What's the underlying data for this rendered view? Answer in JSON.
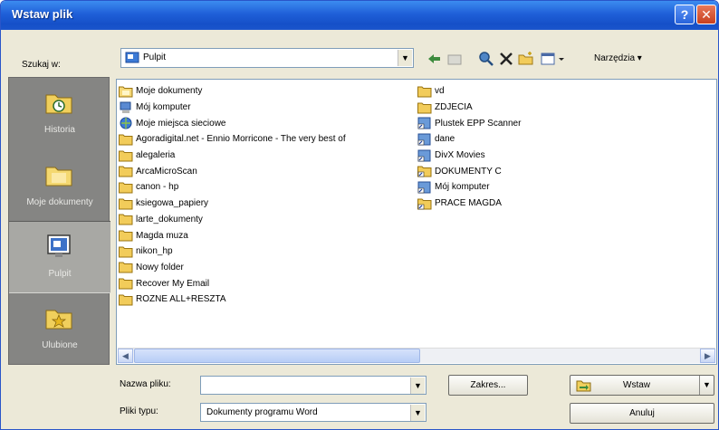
{
  "window": {
    "title": "Wstaw plik"
  },
  "toolbar": {
    "look_in_label": "Szukaj w:",
    "look_in_value": "Pulpit",
    "tools_label": "Narzędzia"
  },
  "places": [
    {
      "label": "Historia"
    },
    {
      "label": "Moje dokumenty"
    },
    {
      "label": "Pulpit"
    },
    {
      "label": "Ulubione"
    }
  ],
  "files": {
    "column1": [
      {
        "name": "Moje dokumenty",
        "icon": "my-documents-icon"
      },
      {
        "name": "Mój komputer",
        "icon": "my-computer-icon"
      },
      {
        "name": "Moje miejsca sieciowe",
        "icon": "network-places-icon"
      },
      {
        "name": "Agoradigital.net - Ennio Morricone - The very best of",
        "icon": "folder-icon"
      },
      {
        "name": "alegaleria",
        "icon": "folder-icon"
      },
      {
        "name": "ArcaMicroScan",
        "icon": "folder-icon"
      },
      {
        "name": "canon - hp",
        "icon": "folder-icon"
      },
      {
        "name": "ksiegowa_papiery",
        "icon": "folder-icon"
      },
      {
        "name": "larte_dokumenty",
        "icon": "folder-icon"
      },
      {
        "name": "Magda muza",
        "icon": "folder-icon"
      },
      {
        "name": "nikon_hp",
        "icon": "folder-icon"
      },
      {
        "name": "Nowy folder",
        "icon": "folder-icon"
      },
      {
        "name": "Recover My Email",
        "icon": "folder-icon"
      },
      {
        "name": "ROZNE ALL+RESZTA",
        "icon": "folder-icon"
      }
    ],
    "column2": [
      {
        "name": "vd",
        "icon": "folder-icon"
      },
      {
        "name": "ZDJECIA",
        "icon": "folder-icon"
      },
      {
        "name": "Plustek EPP Scanner",
        "icon": "shortcut-icon"
      },
      {
        "name": "dane",
        "icon": "shortcut-icon"
      },
      {
        "name": "DivX Movies",
        "icon": "shortcut-icon"
      },
      {
        "name": "DOKUMENTY C",
        "icon": "shortcut-folder-icon"
      },
      {
        "name": "Mój komputer",
        "icon": "shortcut-icon"
      },
      {
        "name": "PRACE MAGDA",
        "icon": "shortcut-folder-icon"
      }
    ]
  },
  "bottom": {
    "file_name_label": "Nazwa pliku:",
    "file_name_value": "",
    "file_type_label": "Pliki typu:",
    "file_type_value": "Dokumenty programu Word",
    "range_button": "Zakres...",
    "insert_button": "Wstaw",
    "cancel_button": "Anuluj"
  },
  "colors": {
    "title_bar": "#1f5fd8",
    "places_bar": "#858583",
    "folder": "#f2cc5a"
  }
}
